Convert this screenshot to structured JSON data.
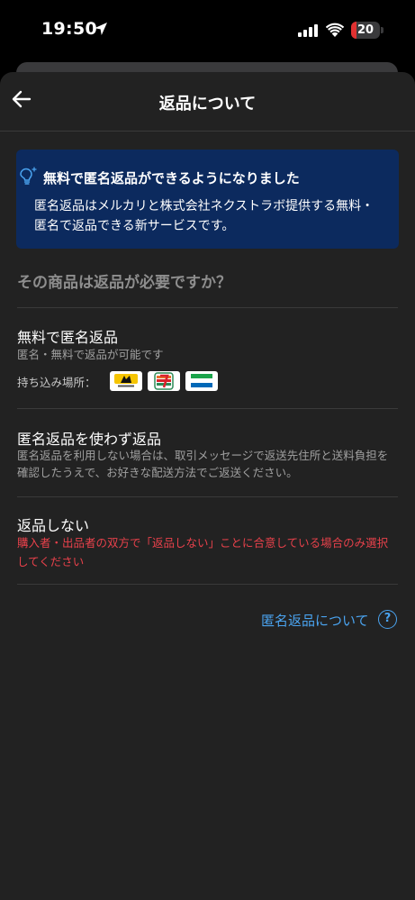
{
  "status_bar": {
    "time": "19:50",
    "battery_level": "20",
    "battery_fraction": 0.2
  },
  "header": {
    "title": "返品について"
  },
  "info_card": {
    "title": "無料で匿名返品ができるようになりました",
    "body": "匿名返品はメルカリと株式会社ネクストラボ提供する無料・匿名で返品できる新サービスです。",
    "icon": "lightbulb-icon"
  },
  "question": "その商品は返品が必要ですか？",
  "options": [
    {
      "title": "無料で匿名返品",
      "subtitle": "匿名・無料で返品が可能です",
      "drop_off_label": "持ち込み場所：",
      "stores": [
        "yamato-logo",
        "seven-eleven-logo",
        "familymart-logo"
      ]
    },
    {
      "title": "匿名返品を使わず返品",
      "subtitle": "匿名返品を利用しない場合は、取引メッセージで返送先住所と送料負担を確認したうえで、お好きな配送方法でご返送ください。"
    },
    {
      "title": "返品しない",
      "warning": "購入者・出品者の双方で「返品しない」ことに合意している場合のみ選択してください"
    }
  ],
  "help_link": {
    "label": "匿名返品について",
    "icon": "question-circle-icon"
  },
  "colors": {
    "sheet_bg": "#222222",
    "card_bg": "#0c2a5e",
    "link": "#4aa3ef",
    "warning": "#e8414b"
  }
}
